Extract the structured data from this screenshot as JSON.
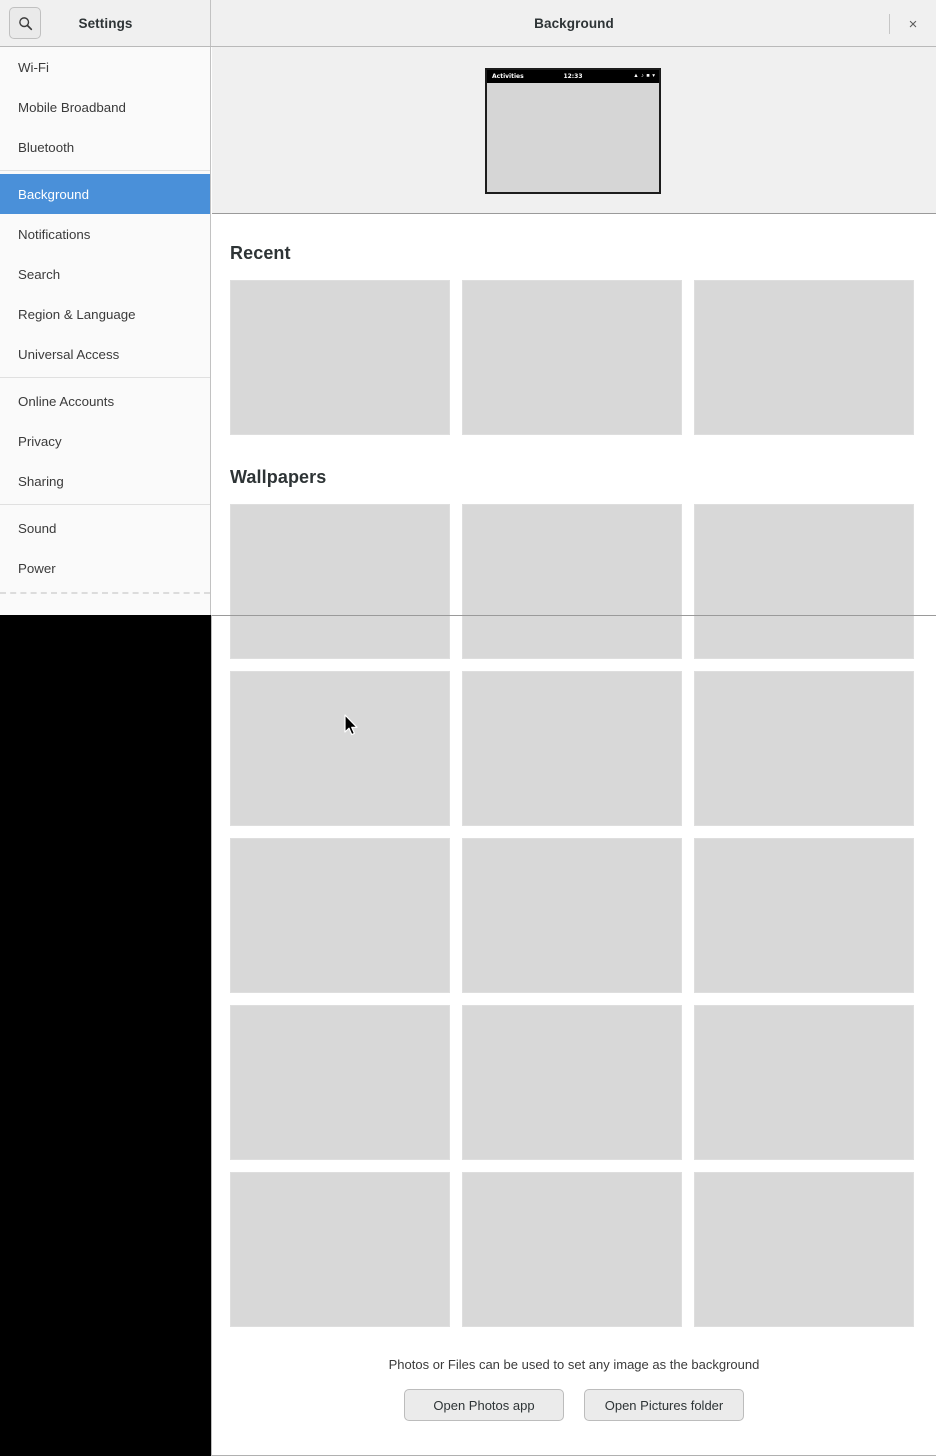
{
  "window": {
    "app_title": "Settings",
    "page_title": "Background",
    "close_label": "×",
    "search_icon": "search-icon"
  },
  "sidebar": {
    "groups": [
      {
        "items": [
          {
            "label": "Wi-Fi",
            "selected": false
          },
          {
            "label": "Mobile Broadband",
            "selected": false
          },
          {
            "label": "Bluetooth",
            "selected": false
          }
        ]
      },
      {
        "items": [
          {
            "label": "Background",
            "selected": true
          },
          {
            "label": "Notifications",
            "selected": false
          },
          {
            "label": "Search",
            "selected": false
          },
          {
            "label": "Region & Language",
            "selected": false
          },
          {
            "label": "Universal Access",
            "selected": false
          }
        ]
      },
      {
        "items": [
          {
            "label": "Online Accounts",
            "selected": false
          },
          {
            "label": "Privacy",
            "selected": false
          },
          {
            "label": "Sharing",
            "selected": false
          }
        ]
      },
      {
        "items": [
          {
            "label": "Sound",
            "selected": false
          },
          {
            "label": "Power",
            "selected": false
          }
        ]
      }
    ]
  },
  "preview": {
    "activities_label": "Activities",
    "clock": "12:33",
    "status_icons": [
      "wifi-icon",
      "volume-icon",
      "battery-icon",
      "chevron-down-icon"
    ]
  },
  "main": {
    "recent": {
      "heading": "Recent",
      "thumbnails": [
        "recent-wallpaper-1",
        "recent-wallpaper-2",
        "recent-wallpaper-3"
      ]
    },
    "wallpapers": {
      "heading": "Wallpapers",
      "thumbnails": [
        "wallpaper-1",
        "wallpaper-2",
        "wallpaper-3",
        "wallpaper-4",
        "wallpaper-5",
        "wallpaper-6",
        "wallpaper-7",
        "wallpaper-8",
        "wallpaper-9",
        "wallpaper-10",
        "wallpaper-11",
        "wallpaper-12",
        "wallpaper-13",
        "wallpaper-14",
        "wallpaper-15"
      ]
    },
    "footer": {
      "note": "Photos or Files can be used to set any image as the background",
      "open_photos_label": "Open Photos app",
      "open_pictures_label": "Open Pictures folder"
    }
  },
  "colors": {
    "accent": "#4a90d9",
    "header_bg": "#f0f0f0",
    "sidebar_bg": "#fafafa",
    "thumb_bg": "#d8d8d8",
    "desktop": "#000000"
  }
}
